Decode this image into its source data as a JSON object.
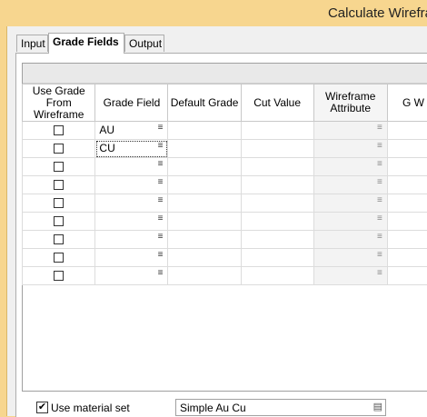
{
  "window": {
    "title": "Calculate Wirefra"
  },
  "tabs": [
    {
      "label": "Input"
    },
    {
      "label": "Grade Fields"
    },
    {
      "label": "Output"
    }
  ],
  "grid": {
    "columns": [
      {
        "label": "Use Grade From Wireframe"
      },
      {
        "label": "Grade Field"
      },
      {
        "label": "Default Grade"
      },
      {
        "label": "Cut Value"
      },
      {
        "label": "Wireframe Attribute"
      },
      {
        "label": "G W"
      }
    ],
    "rows": [
      {
        "use_grade": false,
        "grade_field": "AU",
        "default_grade": "",
        "cut_value": "",
        "wireframe_attribute": ""
      },
      {
        "use_grade": false,
        "grade_field": "CU",
        "default_grade": "",
        "cut_value": "",
        "wireframe_attribute": ""
      },
      {
        "use_grade": false,
        "grade_field": "",
        "default_grade": "",
        "cut_value": "",
        "wireframe_attribute": ""
      },
      {
        "use_grade": false,
        "grade_field": "",
        "default_grade": "",
        "cut_value": "",
        "wireframe_attribute": ""
      },
      {
        "use_grade": false,
        "grade_field": "",
        "default_grade": "",
        "cut_value": "",
        "wireframe_attribute": ""
      },
      {
        "use_grade": false,
        "grade_field": "",
        "default_grade": "",
        "cut_value": "",
        "wireframe_attribute": ""
      },
      {
        "use_grade": false,
        "grade_field": "",
        "default_grade": "",
        "cut_value": "",
        "wireframe_attribute": ""
      },
      {
        "use_grade": false,
        "grade_field": "",
        "default_grade": "",
        "cut_value": "",
        "wireframe_attribute": ""
      },
      {
        "use_grade": false,
        "grade_field": "",
        "default_grade": "",
        "cut_value": "",
        "wireframe_attribute": ""
      }
    ]
  },
  "material_set": {
    "checked": true,
    "label": "Use material set",
    "value": "Simple Au Cu",
    "check_glyph": "✔"
  },
  "icons": {
    "menu": "≡",
    "browse": "▤"
  },
  "colors": {
    "title_bar": "#f7d68f",
    "panel": "#f0f0f0"
  }
}
